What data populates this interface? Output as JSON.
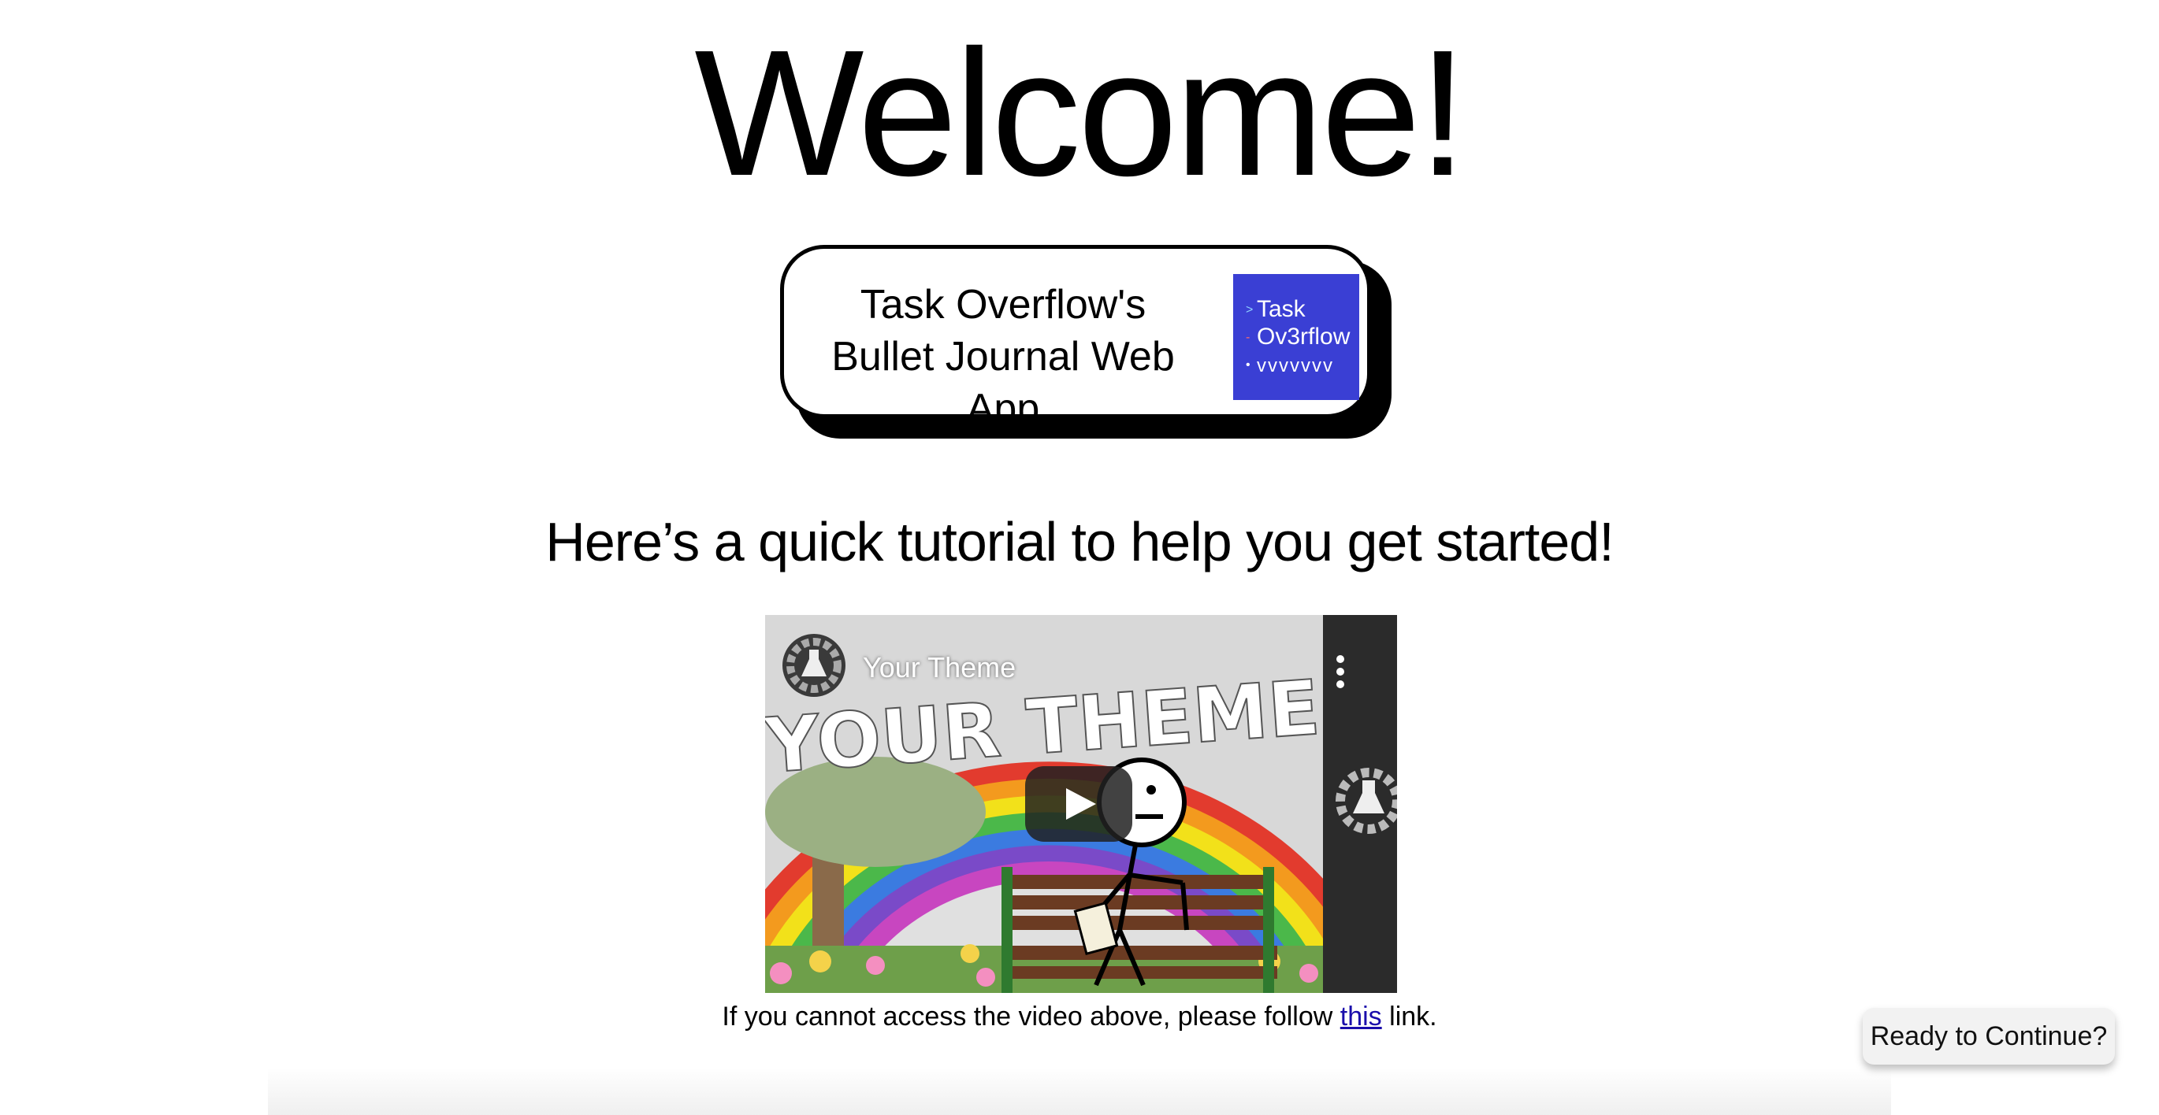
{
  "heading": "Welcome!",
  "logo_card": {
    "line1": "Task Overflow's",
    "line2": "Bullet Journal Web App",
    "tile": {
      "row1": "Task",
      "row2": "Ov3rflow",
      "row3": "vvvvvvv",
      "background": "#3a3fd4"
    }
  },
  "subtitle": "Here’s a quick tutorial to help you get started!",
  "video": {
    "title": "Your Theme",
    "banner_text": "YOUR THEME",
    "icons": [
      "channel-avatar-icon",
      "more-vert-icon",
      "play-icon"
    ]
  },
  "caption": {
    "before": "If you cannot access the video above, please follow ",
    "link": "this",
    "after": " link."
  },
  "continue_button": "Ready to Continue?"
}
